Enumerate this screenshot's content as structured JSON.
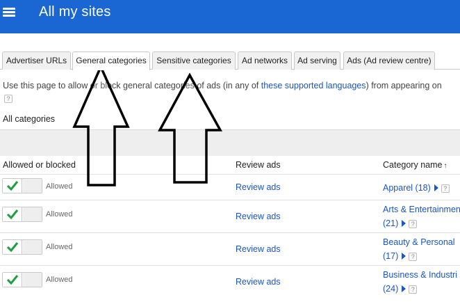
{
  "header": {
    "title": "All my sites"
  },
  "tabs": [
    {
      "label": "Advertiser URLs",
      "active": false
    },
    {
      "label": "General categories",
      "active": true
    },
    {
      "label": "Sensitive categories",
      "active": false
    },
    {
      "label": "Ad networks",
      "active": false
    },
    {
      "label": "Ad serving",
      "active": false
    },
    {
      "label": "Ads (Ad review centre)",
      "active": false
    }
  ],
  "intro": {
    "text_before": "Use this page to allow or block general categories of ads (in any of ",
    "link": "these supported languages",
    "text_after": ") from appearing on",
    "help": "?"
  },
  "all_categories_label": "All categories",
  "table": {
    "headers": {
      "allowed": "Allowed or blocked",
      "review": "Review ads",
      "category": "Category name",
      "sort_indicator": "↑"
    },
    "rows": [
      {
        "status": "Allowed",
        "review": "Review ads",
        "cat_line1": "Apparel (18)",
        "cat_line2": "",
        "help": "?"
      },
      {
        "status": "Allowed",
        "review": "Review ads",
        "cat_line1": "Arts & Entertainmen",
        "cat_line2": "(21)",
        "help": "?"
      },
      {
        "status": "Allowed",
        "review": "Review ads",
        "cat_line1": "Beauty & Personal",
        "cat_line2": "(17)",
        "help": "?"
      },
      {
        "status": "Allowed",
        "review": "Review ads",
        "cat_line1": "Business & Industri",
        "cat_line2": "(24)",
        "help": "?"
      }
    ]
  },
  "colors": {
    "topbar": "#1a66d2",
    "link": "#1a55c4",
    "check": "#1e9e3c"
  },
  "icons": {
    "menu": "hamburger-menu-icon",
    "check": "checkmark-icon",
    "arrow": "up-arrow-annotation"
  }
}
